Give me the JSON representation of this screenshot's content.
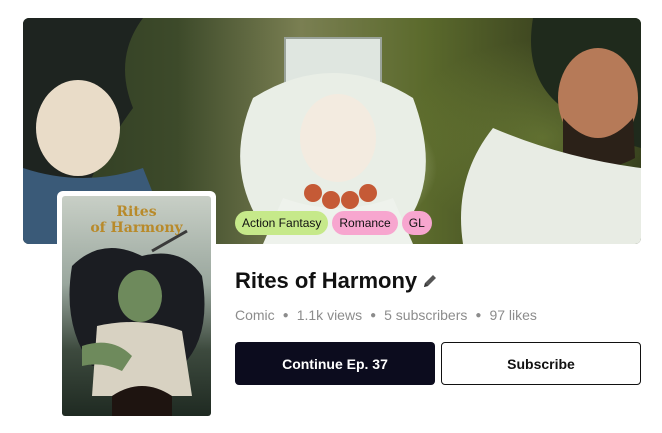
{
  "series": {
    "title": "Rites of Harmony",
    "cover_title_line1": "Rites",
    "cover_title_line2": "of Harmony",
    "tags": [
      "Action Fantasy",
      "Romance",
      "GL"
    ],
    "meta": {
      "type": "Comic",
      "views": "1.1k views",
      "subscribers": "5 subscribers",
      "likes": "97 likes"
    }
  },
  "actions": {
    "continue_label": "Continue Ep. 37",
    "subscribe_label": "Subscribe"
  },
  "icons": {
    "edit": "pencil-icon"
  },
  "colors": {
    "tag_green": "#c6e98a",
    "tag_pink": "#f7a6cf",
    "primary_button": "#0c0c1e"
  }
}
